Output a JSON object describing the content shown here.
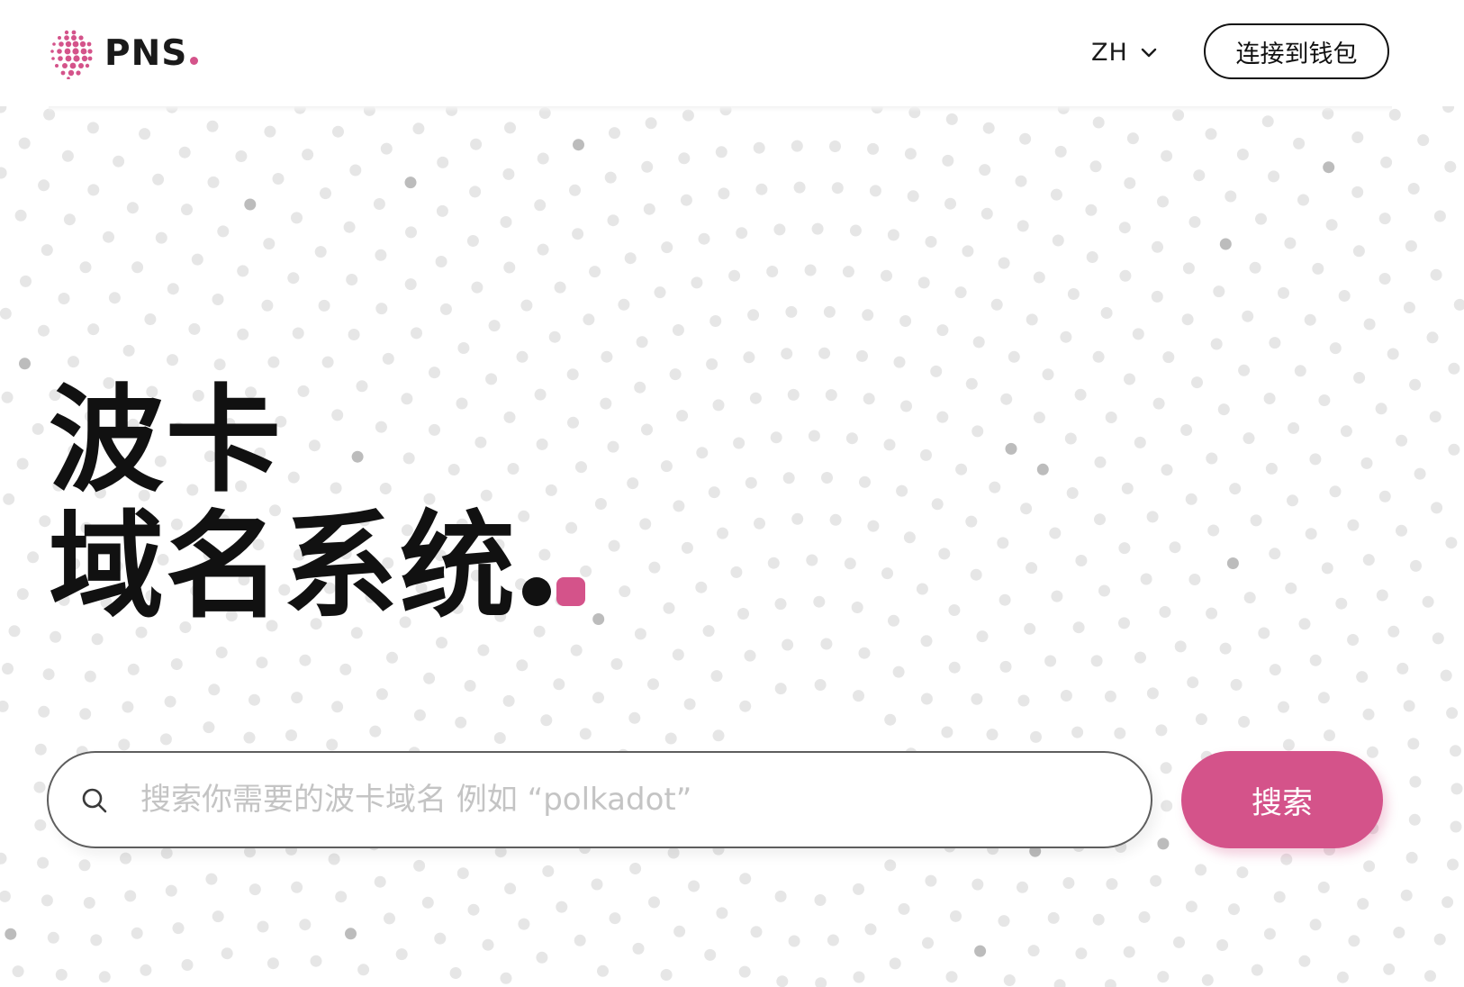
{
  "brand": {
    "name": "PNS",
    "accent_color": "#d4538a",
    "logo_icon": "pns-dot-cluster-logo"
  },
  "header": {
    "language": "ZH",
    "language_icon": "chevron-down-icon",
    "connect_wallet_label": "连接到钱包"
  },
  "hero": {
    "line1": "波卡",
    "line2": "域名系统"
  },
  "search": {
    "placeholder": "搜索你需要的波卡域名 例如 “polkadot”",
    "value": "",
    "icon": "search-icon",
    "button_label": "搜索",
    "button_color": "#d4538a"
  },
  "background": {
    "pattern": "radial-dot-field",
    "dot_color": "#e6e6e6",
    "highlight_dot_color": "#bcbcbc"
  }
}
